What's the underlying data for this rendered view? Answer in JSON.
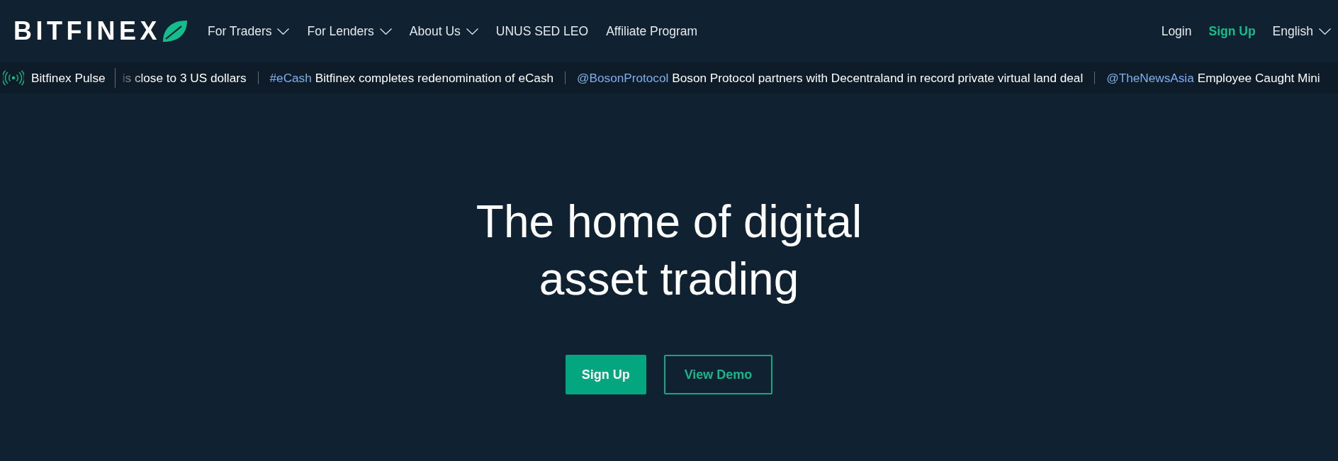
{
  "header": {
    "logo": {
      "text": "BITFINEX"
    },
    "nav": [
      {
        "label": "For Traders",
        "has_menu": true
      },
      {
        "label": "For Lenders",
        "has_menu": true
      },
      {
        "label": "About Us",
        "has_menu": true
      },
      {
        "label": "UNUS SED LEO",
        "has_menu": false
      },
      {
        "label": "Affiliate Program",
        "has_menu": false
      }
    ],
    "actions": [
      {
        "label": "Login",
        "kind": "plain"
      },
      {
        "label": "Sign Up",
        "kind": "accent"
      },
      {
        "label": "English",
        "kind": "menu"
      }
    ]
  },
  "ticker": {
    "title": "Bitfinex Pulse",
    "items": [
      {
        "text": "is close to 3 US dollars"
      },
      {
        "tag": "#eCash",
        "text": "Bitfinex completes redenomination of eCash"
      },
      {
        "tag": "@BosonProtocol",
        "text": "Boson Protocol partners with Decentraland in record private virtual land deal"
      },
      {
        "tag": "@TheNewsAsia",
        "text": "Employee Caught Mini"
      }
    ]
  },
  "hero": {
    "title_lines": [
      "The home of digital",
      "asset trading"
    ],
    "buttons": [
      {
        "label": "Sign Up",
        "kind": "primary"
      },
      {
        "label": "View Demo",
        "kind": "outline"
      }
    ]
  }
}
